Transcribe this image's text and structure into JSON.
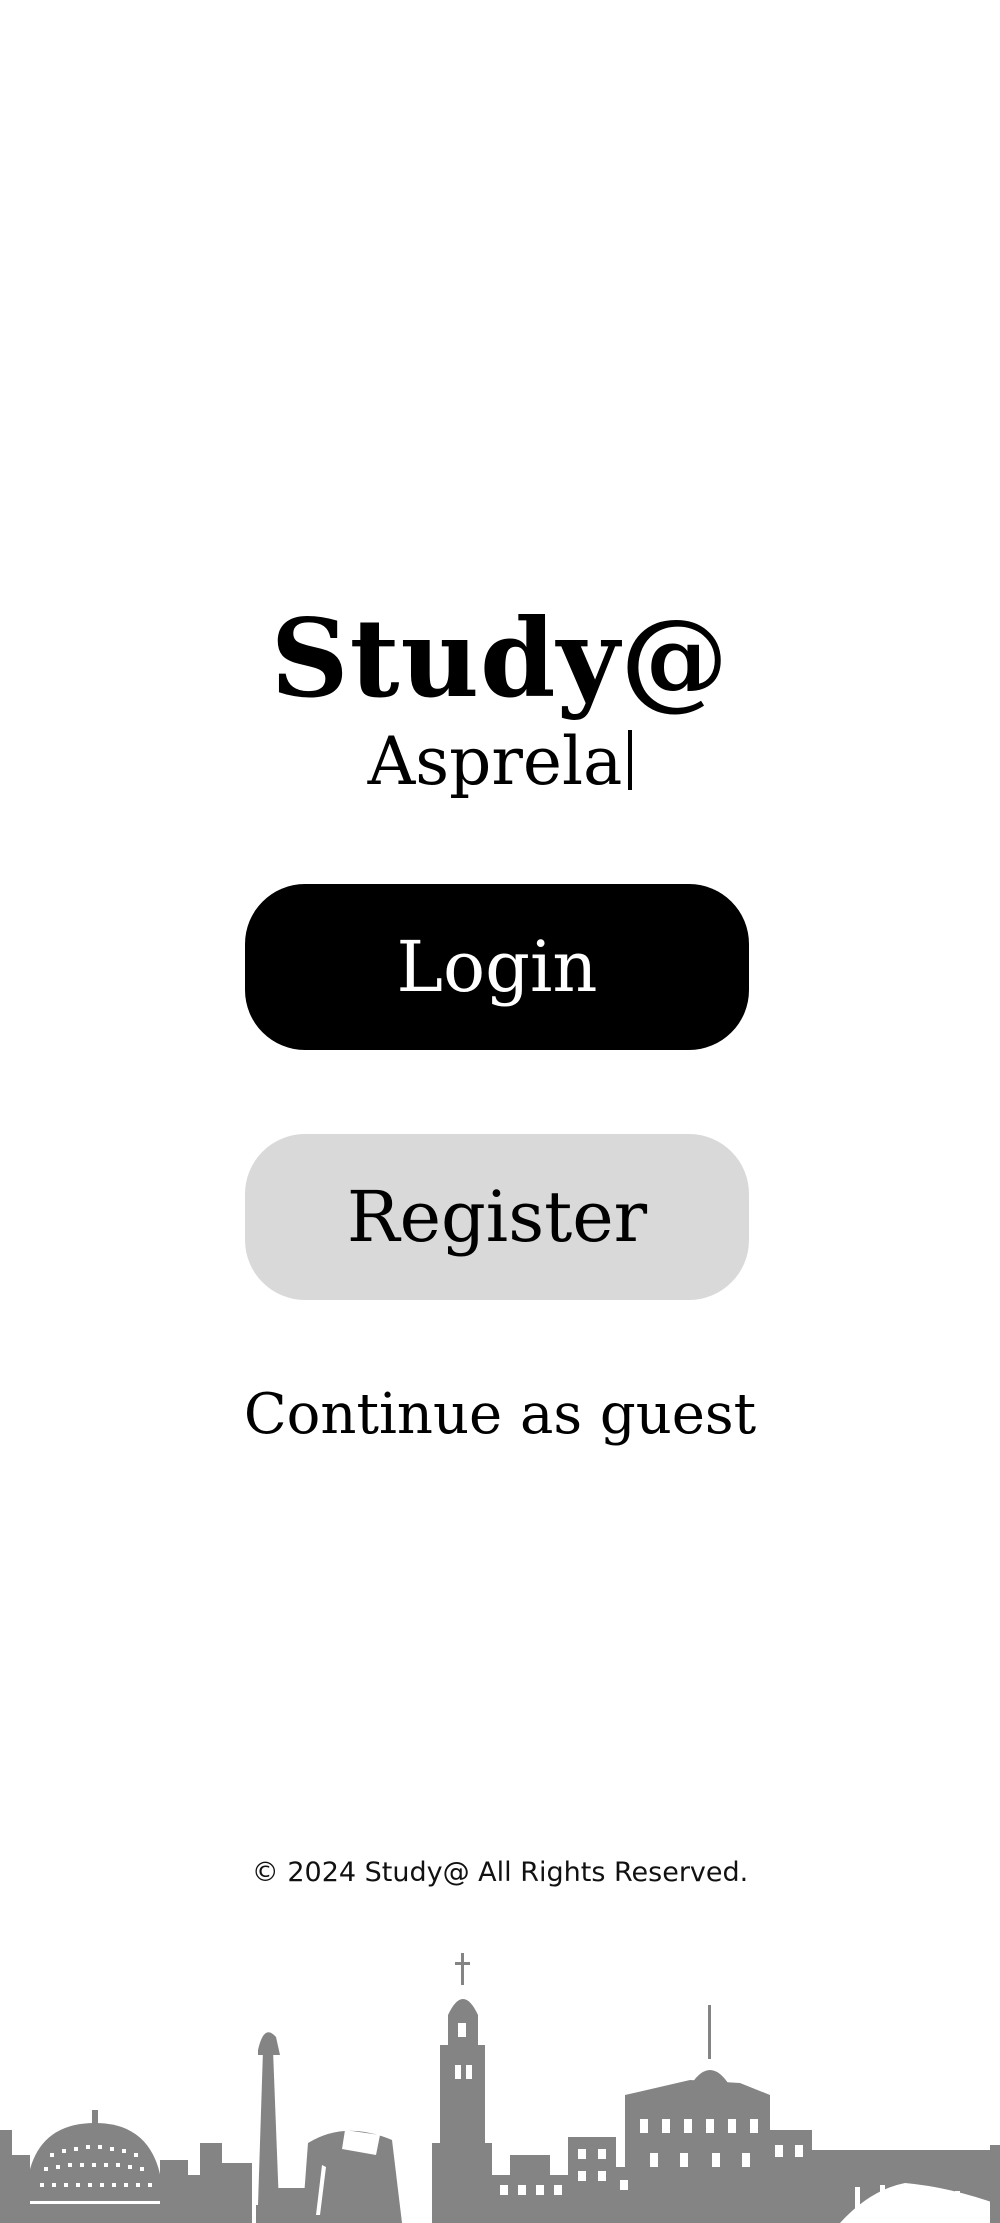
{
  "brand": {
    "title": "Study@",
    "subtitle": "Asprela"
  },
  "actions": {
    "login": "Login",
    "register": "Register",
    "guest": "Continue as guest"
  },
  "footer": {
    "copyright": "© 2024 Study@ All Rights Reserved."
  },
  "colors": {
    "primary": "#000000",
    "secondary_button": "#d9d9d9",
    "skyline": "#848484"
  },
  "icons": {
    "skyline": "porto-city-skyline-illustration"
  }
}
